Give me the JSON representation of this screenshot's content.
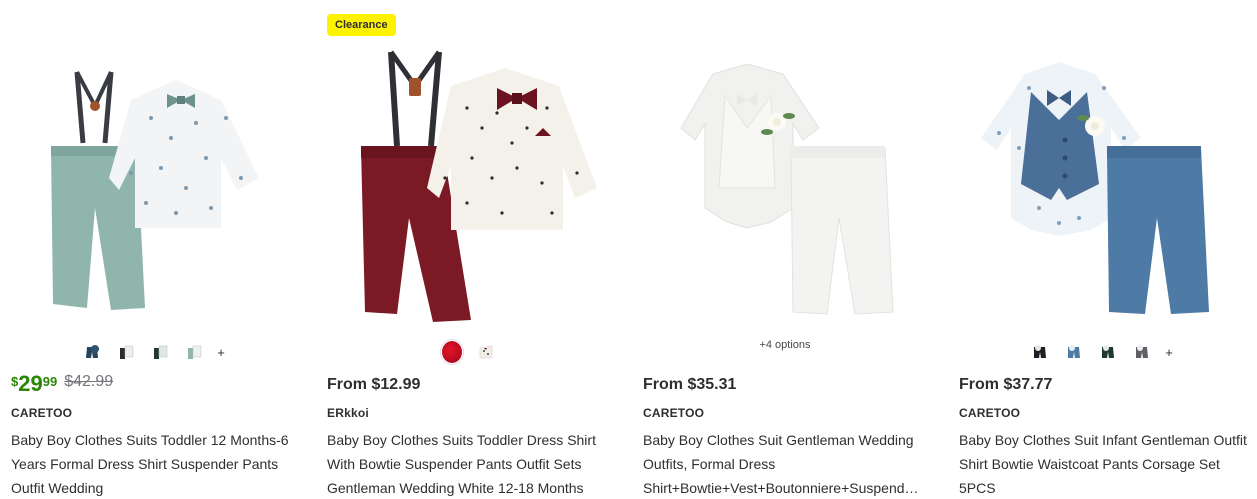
{
  "products": [
    {
      "swatch_more": "+",
      "price_dollars": "29",
      "price_cents": "99",
      "price_currency": "$",
      "price_was": "$42.99",
      "brand": "CARETOO",
      "title": "Baby Boy Clothes Suits Toddler 12 Months-6 Years Formal Dress Shirt Suspender Pants Outfit Wedding",
      "swatch_icons": [
        "outfit-navy",
        "outfit-white",
        "outfit-green",
        "outfit-sage"
      ]
    },
    {
      "flag": "Clearance",
      "price_from": "From $12.99",
      "brand": "ERkkoi",
      "title": "Baby Boy Clothes Suits Toddler Dress Shirt With Bowtie Suspender Pants Outfit Sets Gentleman Wedding White 12-18 Months",
      "swatch_icons": [
        "red-color",
        "white-print"
      ]
    },
    {
      "options_text": "+4 options",
      "price_from": "From $35.31",
      "brand": "CARETOO",
      "title_line1": "Baby Boy Clothes Suit Gentleman Wedding",
      "title_line2": "Outfits, Formal Dress",
      "title_line3": "Shirt+Bowtie+Vest+Boutonniere+Suspend…"
    },
    {
      "swatch_more": "+",
      "price_from": "From $37.77",
      "brand": "CARETOO",
      "title": "Baby Boy Clothes Suit Infant Gentleman Outfit Shirt Bowtie Waistcoat Pants Corsage Set 5PCS",
      "swatch_icons": [
        "outfit-black",
        "outfit-blue",
        "outfit-darkgreen",
        "outfit-grey"
      ]
    }
  ],
  "colors": {
    "price_green": "#2a8703",
    "clearance_yellow": "#fff200",
    "text": "#2e2f32",
    "muted": "#74767c"
  }
}
